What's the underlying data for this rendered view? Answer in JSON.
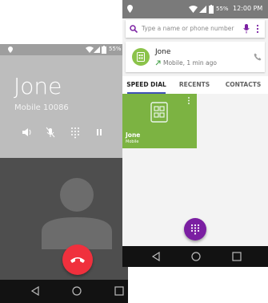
{
  "call_screen": {
    "status_bar": {
      "battery": "55%"
    },
    "contact_name": "Jone",
    "contact_number": "Mobile 10086",
    "colors": {
      "header": "#bdbdbd",
      "end_call": "#f0303d",
      "background": "#4a4a4a"
    }
  },
  "dialer": {
    "status_bar": {
      "battery": "55%",
      "time": "12:00 PM"
    },
    "search": {
      "placeholder": "Type a name or phone number"
    },
    "recent_call": {
      "name": "Jone",
      "detail": "Mobile, 1 min ago"
    },
    "tabs": [
      {
        "label": "SPEED DIAL",
        "selected": true
      },
      {
        "label": "RECENTS",
        "selected": false
      },
      {
        "label": "CONTACTS",
        "selected": false
      }
    ],
    "speed_dial": [
      {
        "name": "Jone",
        "type": "Mobile"
      }
    ],
    "colors": {
      "accent": "#7b1fa2",
      "tile": "#7cb342",
      "avatar": "#8bc34a",
      "tab_indicator": "#3f51b5"
    }
  }
}
